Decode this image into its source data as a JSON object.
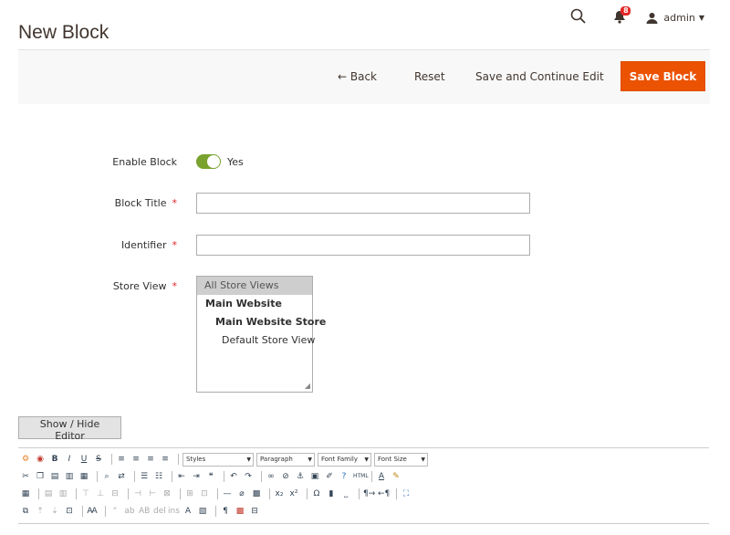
{
  "header": {
    "title": "New Block",
    "notifications_count": "8",
    "user_label": "admin",
    "icons": [
      "search-icon",
      "bell-icon",
      "user-icon",
      "caret-down-icon"
    ]
  },
  "toolbar": {
    "back_label": "← Back",
    "reset_label": "Reset",
    "save_continue_label": "Save and Continue Edit",
    "save_label": "Save Block"
  },
  "form": {
    "enable": {
      "label": "Enable Block",
      "value": "Yes",
      "enabled": true
    },
    "title": {
      "label": "Block Title",
      "required_mark": "*",
      "value": ""
    },
    "identifier": {
      "label": "Identifier",
      "required_mark": "*",
      "value": ""
    },
    "store_view": {
      "label": "Store View",
      "required_mark": "*",
      "options": [
        "All Store Views",
        "Main Website",
        "Main Website Store",
        "Default Store View"
      ],
      "selected": "All Store Views"
    }
  },
  "editor": {
    "toggle_label": "Show / Hide Editor",
    "dropdowns": [
      "Styles",
      "Paragraph",
      "Font Family",
      "Font Size"
    ]
  },
  "colors": {
    "primary_button": "#eb5202",
    "toggle_on": "#79a22e",
    "required": "#e22626",
    "toolbar_bg": "#f8f8f8"
  }
}
